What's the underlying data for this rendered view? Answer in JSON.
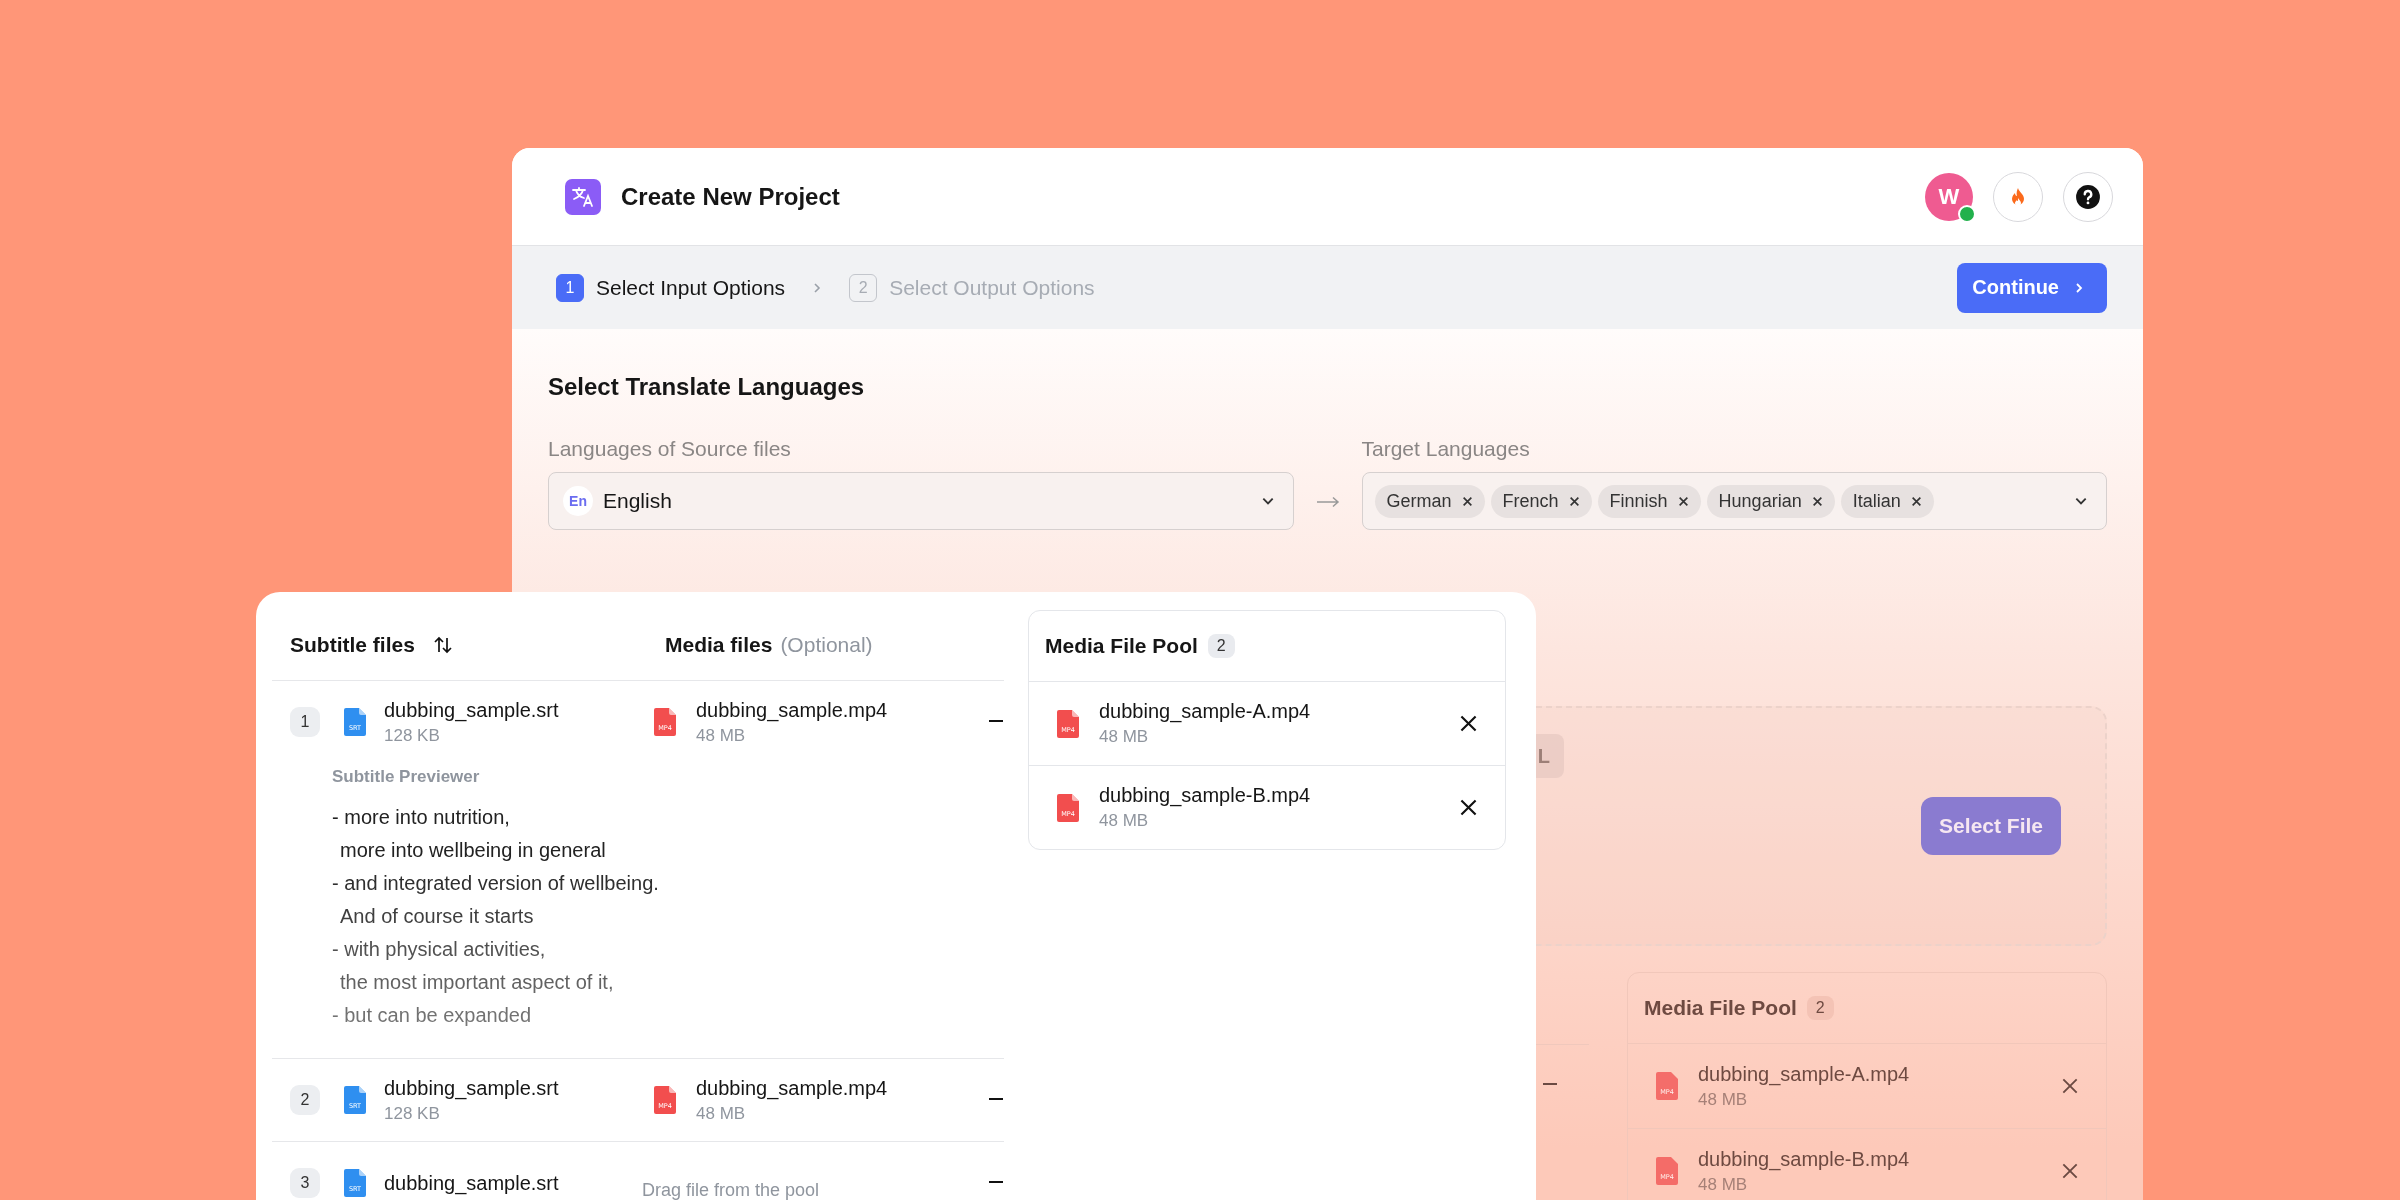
{
  "window": {
    "title": "Create New Project"
  },
  "user": {
    "initial": "W",
    "online": true
  },
  "stepper": {
    "steps": [
      {
        "number": "1",
        "label": "Select Input Options",
        "selected": true
      },
      {
        "number": "2",
        "label": "Select Output Options",
        "selected": false
      }
    ],
    "continue_button": "Continue"
  },
  "languages": {
    "title": "Select Translate Languages",
    "source": {
      "label": "Languages of Source files",
      "code": "En",
      "value": "English"
    },
    "target": {
      "label": "Target Languages",
      "tags": [
        "German",
        "French",
        "Finnish",
        "Hungarian",
        "Italian"
      ]
    }
  },
  "upload_area": {
    "chip": "L",
    "button": "Select File"
  },
  "background_pool": {
    "title": "Media File Pool",
    "count": "2",
    "files": [
      {
        "name": "dubbing_sample-A.mp4",
        "size": "48 MB",
        "format": "MP4",
        "kind": "video"
      },
      {
        "name": "dubbing_sample-B.mp4",
        "size": "48 MB",
        "format": "MP4",
        "kind": "video"
      }
    ]
  },
  "file_card": {
    "columns": {
      "subtitle": "Subtitle files",
      "media": "Media files",
      "media_note": "(Optional)"
    },
    "pairs": [
      {
        "number": "1",
        "subtitle": {
          "name": "dubbing_sample.srt",
          "size": "128 KB",
          "format": "SRT",
          "kind": "subtitle"
        },
        "media": {
          "name": "dubbing_sample.mp4",
          "size": "48 MB",
          "format": "MP4",
          "kind": "video"
        },
        "preview": {
          "title": "Subtitle Previewer",
          "lines": [
            "- more into nutrition,",
            "more into wellbeing in general",
            "- and integrated version of wellbeing.",
            "And of course it starts",
            "- with physical activities,",
            "the most important aspect of it,",
            "- but can be expanded"
          ]
        }
      },
      {
        "number": "2",
        "subtitle": {
          "name": "dubbing_sample.srt",
          "size": "128 KB",
          "format": "SRT",
          "kind": "subtitle"
        },
        "media": {
          "name": "dubbing_sample.mp4",
          "size": "48 MB",
          "format": "MP4",
          "kind": "video"
        }
      },
      {
        "number": "3",
        "subtitle": {
          "name": "dubbing_sample.srt",
          "format": "SRT",
          "kind": "subtitle"
        },
        "media_placeholder": "Drag file from the pool"
      }
    ],
    "pool": {
      "title": "Media File Pool",
      "count": "2",
      "files": [
        {
          "name": "dubbing_sample-A.mp4",
          "size": "48 MB",
          "format": "MP4",
          "kind": "video"
        },
        {
          "name": "dubbing_sample-B.mp4",
          "size": "48 MB",
          "format": "MP4",
          "kind": "video"
        }
      ]
    }
  }
}
